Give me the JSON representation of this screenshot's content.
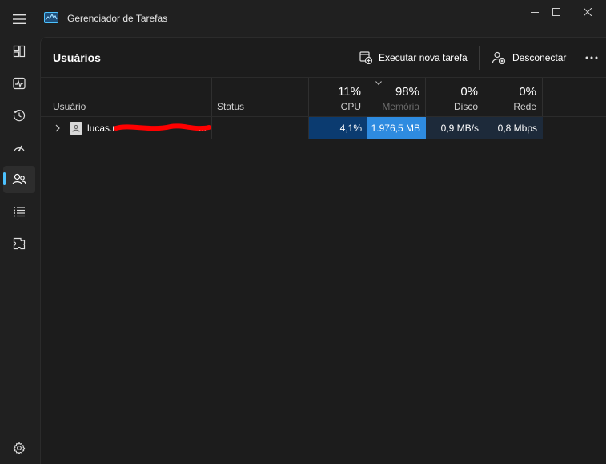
{
  "window": {
    "title": "Gerenciador de Tarefas"
  },
  "nav": {
    "items": [
      {
        "name": "processes",
        "icon": "processes-icon"
      },
      {
        "name": "performance",
        "icon": "performance-icon"
      },
      {
        "name": "app-history",
        "icon": "history-icon"
      },
      {
        "name": "startup",
        "icon": "startup-icon"
      },
      {
        "name": "users",
        "icon": "users-icon",
        "active": true
      },
      {
        "name": "details",
        "icon": "details-icon"
      },
      {
        "name": "services",
        "icon": "services-icon"
      }
    ],
    "settings_icon": "gear-icon"
  },
  "page": {
    "title": "Usuários",
    "run_task_label": "Executar nova tarefa",
    "disconnect_label": "Desconectar"
  },
  "table": {
    "columns": {
      "user": "Usuário",
      "status": "Status",
      "cpu": {
        "pct": "11%",
        "label": "CPU"
      },
      "memory": {
        "pct": "98%",
        "label": "Memória"
      },
      "disk": {
        "pct": "0%",
        "label": "Disco"
      },
      "network": {
        "pct": "0%",
        "label": "Rede"
      }
    },
    "rows": [
      {
        "user": "lucas.r",
        "user_suffix": "...",
        "status": "",
        "cpu": "4,1%",
        "memory": "1.976,5 MB",
        "disk": "0,9 MB/s",
        "network": "0,8 Mbps"
      }
    ]
  },
  "colors": {
    "accent": "#4cc2ff",
    "cpu_cell": "#0b3b70",
    "memory_cell": "#2e8be0",
    "disk_cell": "#1d2a3a",
    "network_cell": "#1d2a3a",
    "redaction": "#ff0000"
  }
}
